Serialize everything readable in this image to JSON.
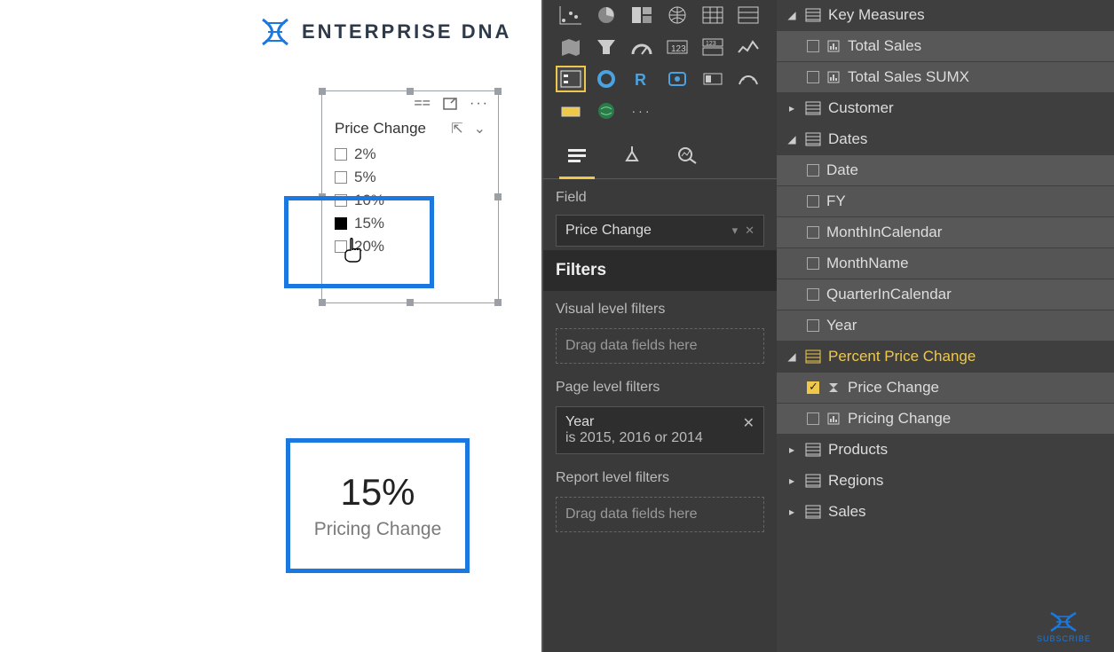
{
  "brand": {
    "name": "ENTERPRISE DNA"
  },
  "slicer": {
    "title": "Price Change",
    "options": [
      "2%",
      "5%",
      "10%",
      "15%",
      "20%"
    ],
    "checked_index": 3
  },
  "card": {
    "value": "15%",
    "label": "Pricing Change"
  },
  "viz": {
    "field_section": "Field",
    "field_value": "Price Change",
    "filters_header": "Filters",
    "visual_filters_label": "Visual level filters",
    "visual_drop": "Drag data fields here",
    "page_filters_label": "Page level filters",
    "page_filter_field": "Year",
    "page_filter_summary": "is 2015, 2016 or 2014",
    "report_filters_label": "Report level filters",
    "report_drop": "Drag data fields here"
  },
  "fields": {
    "key_measures": {
      "label": "Key Measures",
      "items": [
        "Total Sales",
        "Total Sales SUMX"
      ]
    },
    "customer": {
      "label": "Customer"
    },
    "dates": {
      "label": "Dates",
      "items": [
        "Date",
        "FY",
        "MonthInCalendar",
        "MonthName",
        "QuarterInCalendar",
        "Year"
      ]
    },
    "percent_price_change": {
      "label": "Percent Price Change",
      "items": [
        {
          "name": "Price Change",
          "checked": true,
          "sigma": true
        },
        {
          "name": "Pricing Change",
          "checked": false,
          "sigma": false
        }
      ]
    },
    "products": {
      "label": "Products"
    },
    "regions": {
      "label": "Regions"
    },
    "sales": {
      "label": "Sales"
    }
  },
  "subscribe": {
    "label": "SUBSCRIBE"
  }
}
